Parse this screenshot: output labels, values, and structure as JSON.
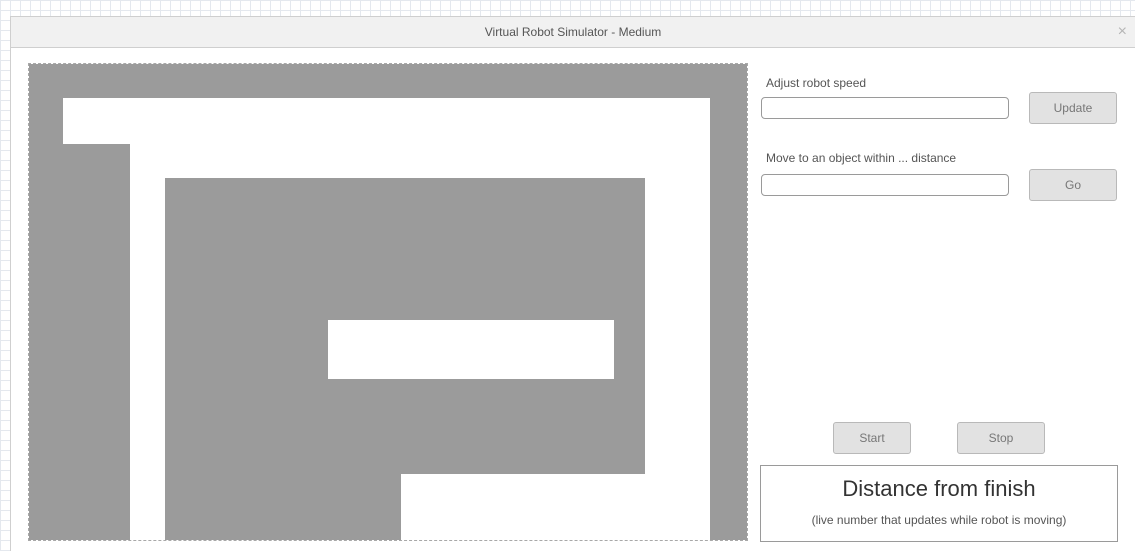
{
  "window": {
    "title": "Virtual Robot Simulator - Medium",
    "close_glyph": "×"
  },
  "controls": {
    "speed": {
      "label": "Adjust robot speed",
      "value": "",
      "button_label": "Update"
    },
    "move": {
      "label": "Move to an object within ... distance",
      "value": "",
      "button_label": "Go"
    },
    "start_label": "Start",
    "stop_label": "Stop"
  },
  "distance": {
    "title": "Distance from finish",
    "subtitle": "(live number that updates while robot is moving)"
  },
  "colors": {
    "maze_wall": "#9b9b9b",
    "maze_path": "#ffffff"
  }
}
